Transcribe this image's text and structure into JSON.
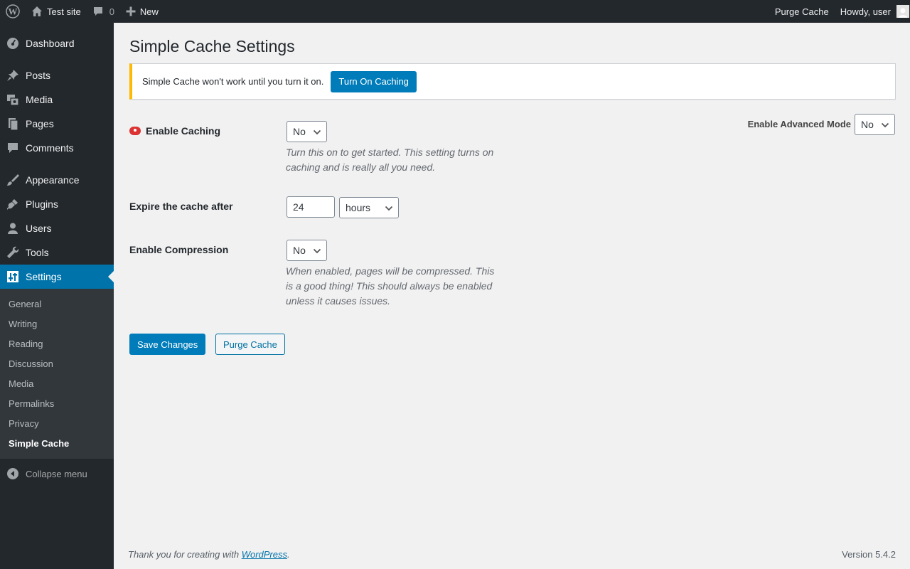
{
  "adminbar": {
    "site_name": "Test site",
    "comments_count": "0",
    "new_label": "New",
    "purge_label": "Purge Cache",
    "howdy": "Howdy, user"
  },
  "menu": {
    "items": [
      {
        "label": "Dashboard",
        "icon": "dashboard-icon"
      },
      {
        "label": "Posts",
        "icon": "pin-icon"
      },
      {
        "label": "Media",
        "icon": "media-icon"
      },
      {
        "label": "Pages",
        "icon": "pages-icon"
      },
      {
        "label": "Comments",
        "icon": "comment-icon"
      },
      {
        "label": "Appearance",
        "icon": "brush-icon"
      },
      {
        "label": "Plugins",
        "icon": "plug-icon"
      },
      {
        "label": "Users",
        "icon": "user-icon"
      },
      {
        "label": "Tools",
        "icon": "wrench-icon"
      },
      {
        "label": "Settings",
        "icon": "sliders-icon"
      }
    ],
    "submenu": [
      "General",
      "Writing",
      "Reading",
      "Discussion",
      "Media",
      "Permalinks",
      "Privacy",
      "Simple Cache"
    ],
    "collapse": "Collapse menu"
  },
  "page": {
    "title": "Simple Cache Settings",
    "notice_text": "Simple Cache won't work until you turn it on.",
    "notice_button": "Turn On Caching",
    "advanced_mode_label": "Enable Advanced Mode",
    "advanced_mode_value": "No",
    "enable_caching_label": "Enable Caching",
    "enable_caching_value": "No",
    "enable_caching_desc_1": "Turn this on to get started. This setting turns on",
    "enable_caching_desc_2": "caching and is really all you need.",
    "expire_label": "Expire the cache after",
    "expire_value": "24",
    "expire_unit": "hours",
    "compression_label": "Enable Compression",
    "compression_value": "No",
    "compression_desc_1": "When enabled, pages will be compressed. This",
    "compression_desc_2": "is a good thing! This should always be enabled",
    "compression_desc_3": "unless it causes issues.",
    "save_button": "Save Changes",
    "purge_button": "Purge Cache"
  },
  "footer": {
    "thanks_prefix": "Thank you for creating with",
    "thanks_link": "WordPress",
    "thanks_suffix": ".",
    "version": "Version 5.4.2"
  },
  "colors": {
    "accent": "#0073aa",
    "button_primary": "#007cba",
    "notice_warning": "#ffb900",
    "status_off": "#dc3232",
    "sidebar_bg": "#23282d"
  }
}
